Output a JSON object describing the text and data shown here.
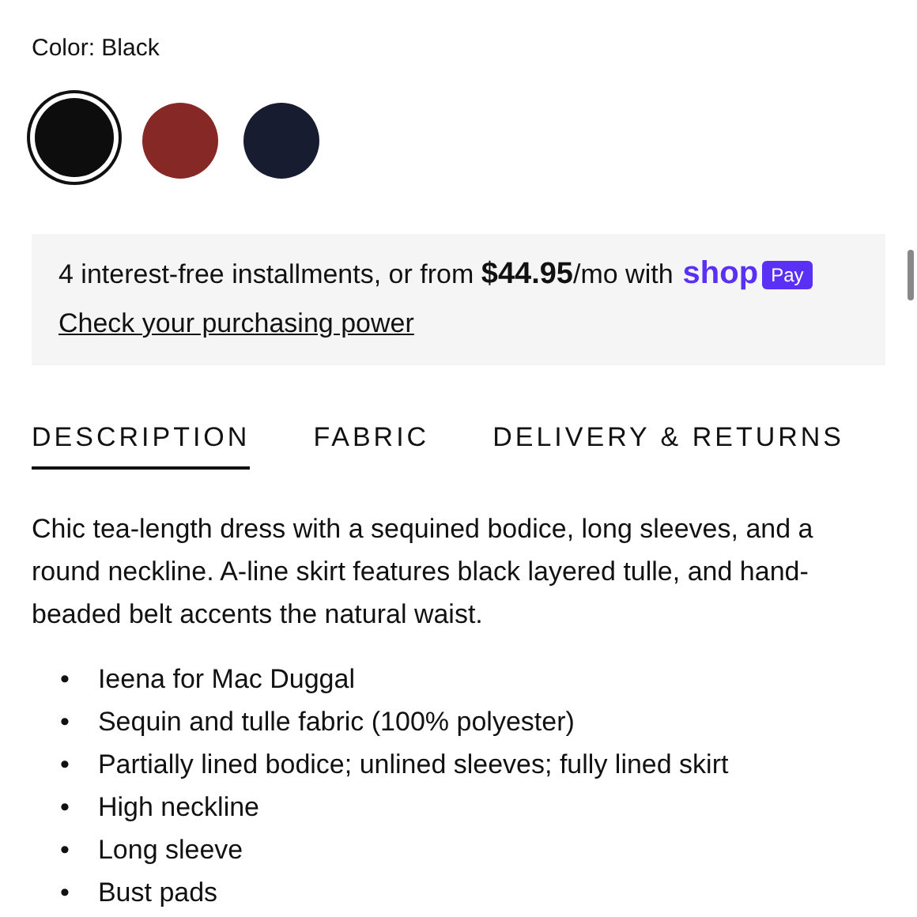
{
  "color_picker": {
    "label": "Color: Black",
    "swatches": [
      {
        "color": "#0d0d0d",
        "selected": true
      },
      {
        "color": "#862826",
        "selected": false
      },
      {
        "color": "#171c30",
        "selected": false
      }
    ]
  },
  "installments": {
    "text": "4 interest-free installments, or from **$44.95**/mo with",
    "logo": "shop",
    "badge": "Pay",
    "link": "Check your purchasing power"
  },
  "tabs": [
    {
      "label": "DESCRIPTION",
      "selected": true
    },
    {
      "label": "FABRIC",
      "selected": false
    },
    {
      "label": "DELIVERY & RETURNS",
      "selected": false
    }
  ],
  "description": "Chic tea-length dress with a sequined bodice, long sleeves, and a round neckline. A-line skirt features black layered tulle, and hand-beaded belt accents the natural waist.",
  "features": [
    {
      "bullet": "•",
      "text": "Ieena for Mac Duggal"
    },
    {
      "bullet": "•",
      "text": "Sequin and tulle fabric (100% polyester)"
    },
    {
      "bullet": "•",
      "text": "Partially lined bodice; unlined sleeves; fully lined skirt"
    },
    {
      "bullet": "•",
      "text": "High neckline"
    },
    {
      "bullet": "•",
      "text": "Long sleeve"
    },
    {
      "bullet": "•",
      "text": "Bust pads"
    }
  ]
}
